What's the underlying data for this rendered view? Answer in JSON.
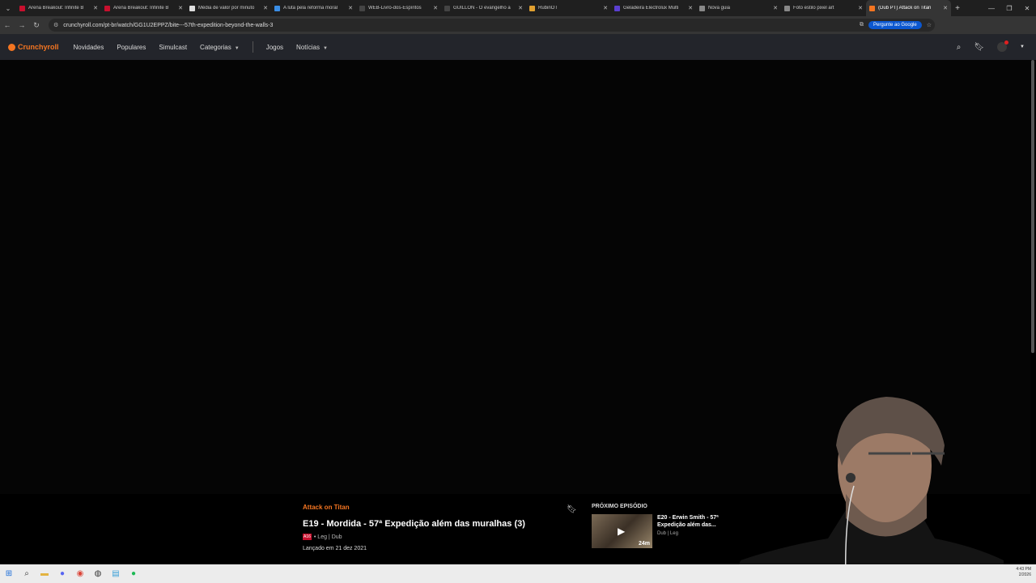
{
  "browser": {
    "tabs": [
      {
        "label": "Arena Breakout: Infinite B",
        "color": "#c8102e"
      },
      {
        "label": "Arena Breakout: Infinite B",
        "color": "#c8102e"
      },
      {
        "label": "Média de valor por minuto",
        "color": "#dddddd"
      },
      {
        "label": "A luta pela reforma moral",
        "color": "#3a8ee6"
      },
      {
        "label": "WEB-Livro-dos-Espíritos",
        "color": "#444444"
      },
      {
        "label": "GUILLON - O evangelho a",
        "color": "#444444"
      },
      {
        "label": "RubinOT",
        "color": "#e0a030"
      },
      {
        "label": "Geladeira Electrolux Multi",
        "color": "#5b3fd0"
      },
      {
        "label": "Nova guia",
        "color": "#888888"
      },
      {
        "label": "Foto estilo pixel art",
        "color": "#888888"
      },
      {
        "label": "(Dub PT) Attack on Titan",
        "color": "#f47521",
        "active": true
      }
    ],
    "url": "crunchyroll.com/pt-br/watch/GG1U2EPPZ/bite---57th-expedition-beyond-the-walls-3",
    "google_button": "Pergunte ao Google"
  },
  "site": {
    "logo": "Crunchyroll",
    "menu": [
      "Novidades",
      "Populares",
      "Simulcast",
      "Categorias",
      "Jogos",
      "Notícias"
    ]
  },
  "episode": {
    "series": "Attack on Titan",
    "title": "E19 - Mordida - 57ª Expedição além das muralhas (3)",
    "rating": "A16",
    "tags": "• Leg | Dub",
    "date": "Lançado em 21 dez 2021"
  },
  "next": {
    "heading": "PRÓXIMO EPISÓDIO",
    "title": "E20 - Erwin Smith - 57ª Expedição além das...",
    "meta": "Dub | Leg",
    "duration": "24m"
  },
  "clock": {
    "time": "4:43 PM",
    "date": "2/2026"
  }
}
